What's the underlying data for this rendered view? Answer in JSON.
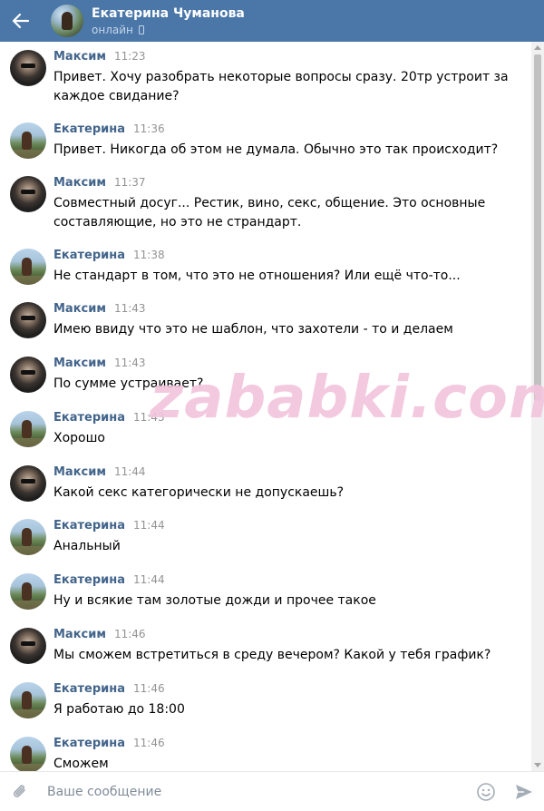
{
  "header": {
    "contact_name": "Екатерина Чуманова",
    "status": "онлайн"
  },
  "messages": [
    {
      "author": "Максим",
      "time": "11:23",
      "text": "Привет. Хочу разобрать некоторые вопросы сразу. 20тр устроит за каждое свидание?",
      "sender": "max"
    },
    {
      "author": "Екатерина",
      "time": "11:36",
      "text": "Привет. Никогда об этом не думала. Обычно это так происходит?",
      "sender": "kat"
    },
    {
      "author": "Максим",
      "time": "11:37",
      "text": "Совместный досуг... Рестик, вино, секс, общение. Это основные составляющие, но это не страндарт.",
      "sender": "max"
    },
    {
      "author": "Екатерина",
      "time": "11:38",
      "text": "Не стандарт в том, что это не отношения? Или ещё что-то...",
      "sender": "kat"
    },
    {
      "author": "Максим",
      "time": "11:43",
      "text": "Имею ввиду что это не шаблон, что захотели - то и делаем",
      "sender": "max"
    },
    {
      "author": "Максим",
      "time": "11:43",
      "text": "По сумме устраивает?",
      "sender": "max"
    },
    {
      "author": "Екатерина",
      "time": "11:43",
      "text": "Хорошо",
      "sender": "kat"
    },
    {
      "author": "Максим",
      "time": "11:44",
      "text": "Какой секс категорически не допускаешь?",
      "sender": "max"
    },
    {
      "author": "Екатерина",
      "time": "11:44",
      "text": "Анальный",
      "sender": "kat"
    },
    {
      "author": "Екатерина",
      "time": "11:44",
      "text": "Ну и всякие там золотые дожди и прочее такое",
      "sender": "kat"
    },
    {
      "author": "Максим",
      "time": "11:46",
      "text": "Мы сможем встретиться в среду вечером? Какой у тебя график?",
      "sender": "max"
    },
    {
      "author": "Екатерина",
      "time": "11:46",
      "text": "Я работаю до 18:00",
      "sender": "kat"
    },
    {
      "author": "Екатерина",
      "time": "11:46",
      "text": "Сможем",
      "sender": "kat"
    }
  ],
  "watermark": "zababki.com",
  "composer": {
    "placeholder": "Ваше сообщение"
  },
  "colors": {
    "header_bg": "#4a76a8",
    "author_name": "#42648b",
    "timestamp": "#939393",
    "watermark": "#f2c4dc"
  }
}
